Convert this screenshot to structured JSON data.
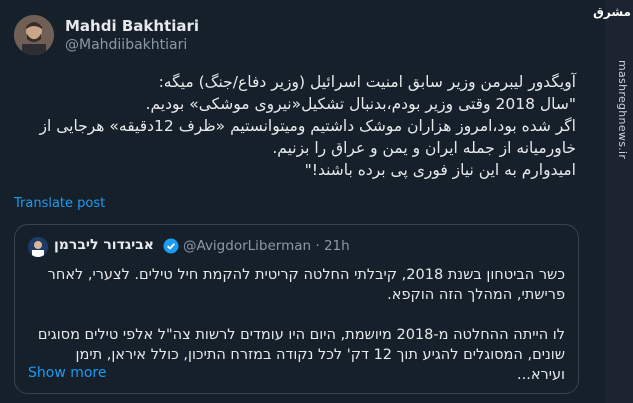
{
  "author": {
    "name": "Mahdi Bakhtiari",
    "handle": "@Mahdiibakhtiari"
  },
  "tweet": {
    "text": "آویگدور لیبرمن وزیر سابق امنیت اسرائیل (وزیر دفاع/جنگ) میگه:\n\"سال 2018 وقتی وزیر بودم،بدنبال تشکیل«نیروی موشکی» بودیم.\nاگر شده بود،امروز هزاران موشک داشتیم ومیتوانستیم «ظرف 12دقیقه» هرجایی از\nخاورمیانه از جمله ایران و یمن و عراق را بزنیم.\nامیدوارم به این نیاز فوری پی برده باشند!\"",
    "translate_label": "Translate post"
  },
  "quote": {
    "name": "אביגדור ליברמן",
    "handle": "@AvigdorLiberman",
    "separator": "·",
    "time": "21h",
    "paragraph1": "כשר הביטחון בשנת 2018, קיבלתי החלטה קריטית להקמת חיל טילים. לצערי, לאחר פרישתי, המהלך הזה הוקפא.",
    "paragraph2": "לו הייתה ההחלטה מ-2018 מיושמת, היום היו עומדים לרשות צה\"ל אלפי טילים מסוגים שונים, המסוגלים להגיע תוך 12 דק' לכל נקודה במזרח התיכון, כולל איראן, תימן ועירא...",
    "show_more_label": "Show more"
  },
  "sidebar": {
    "logo_text": "مشرق",
    "site_text": "mashreghnews.ir"
  },
  "colors": {
    "background": "#15202b",
    "link": "#1d9bf0",
    "verified": "#1d9bf0"
  }
}
